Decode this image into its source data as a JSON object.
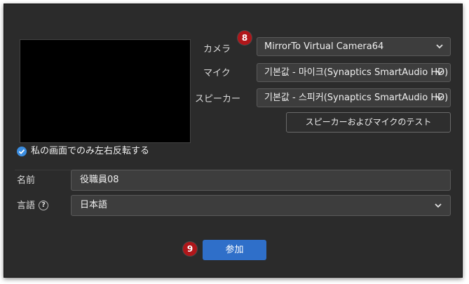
{
  "colors": {
    "background": "#2b2b2b",
    "accent": "#2f6fc9",
    "checkbox": "#3b8de0",
    "badge": "#b0161a"
  },
  "devices": {
    "camera_label": "カメラ",
    "camera_value": "MirrorTo Virtual Camera64",
    "mic_label": "マイク",
    "mic_value": "기본값 - 마이크(Synaptics SmartAudio HD)",
    "speaker_label": "スピーカー",
    "speaker_value": "기본값 - 스피커(Synaptics SmartAudio HD)",
    "test_button_label": "スピーカーおよびマイクのテスト"
  },
  "mirror": {
    "checked": true,
    "label": "私の画面でのみ左右反転する"
  },
  "name": {
    "label": "名前",
    "value": "役職員08"
  },
  "language": {
    "label": "言語",
    "help_icon": "?",
    "value": "日本語"
  },
  "join_button_label": "参加",
  "badges": {
    "camera_step": "8",
    "join_step": "9"
  }
}
